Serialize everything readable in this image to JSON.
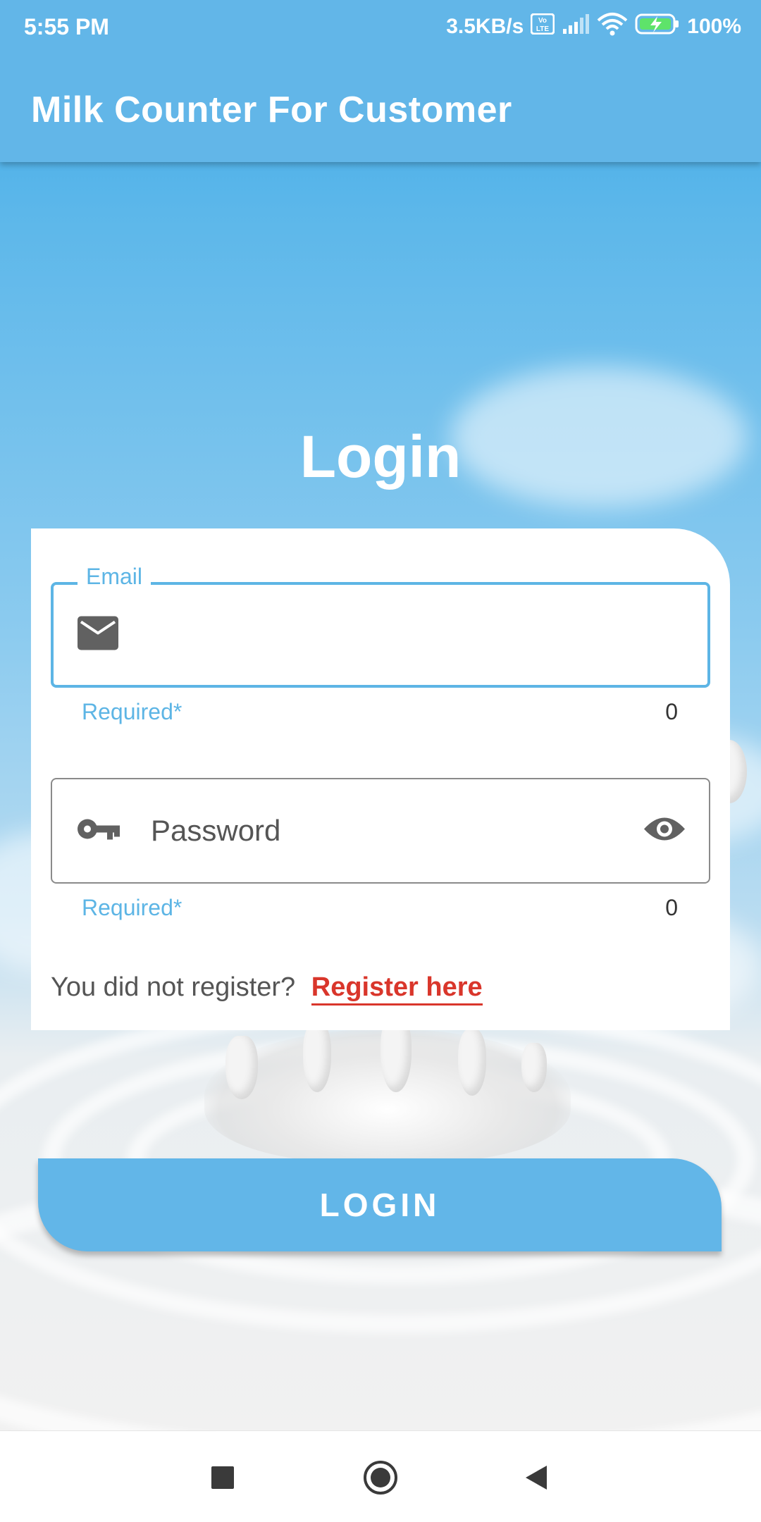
{
  "status_bar": {
    "time": "5:55 PM",
    "network_speed": "3.5KB/s",
    "battery": "100%",
    "icons": [
      "volte-icon",
      "signal-icon",
      "wifi-icon",
      "battery-charging-icon"
    ]
  },
  "app_bar": {
    "title": "Milk Counter For Customer"
  },
  "login": {
    "heading": "Login",
    "email": {
      "label": "Email",
      "value": "",
      "helper": "Required*",
      "counter": "0",
      "icon": "mail-icon"
    },
    "password": {
      "placeholder": "Password",
      "value": "",
      "helper": "Required*",
      "counter": "0",
      "icon": "key-icon",
      "toggle_icon": "eye-icon"
    },
    "register_prompt": "You did not register?",
    "register_link": "Register here",
    "button_label": "LOGIN"
  },
  "nav_bar": {
    "buttons": [
      "recents-square-icon",
      "home-circle-icon",
      "back-triangle-icon"
    ]
  },
  "colors": {
    "primary": "#62b6e8",
    "accent": "#5db5e5",
    "link": "#d9362b"
  }
}
